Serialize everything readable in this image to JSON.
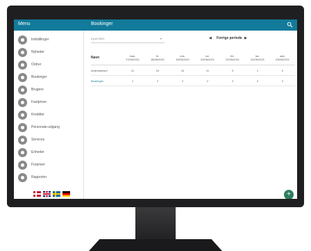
{
  "app": {
    "menu_title": "Menu",
    "page_title": "Bookinger"
  },
  "sidebar": {
    "items": [
      {
        "label": "Indstillinger",
        "icon": "settings-icon"
      },
      {
        "label": "Nyheder",
        "icon": "news-icon"
      },
      {
        "label": "Ordrer",
        "icon": "orders-icon"
      },
      {
        "label": "Bookinger",
        "icon": "bookings-icon"
      },
      {
        "label": "Brugere",
        "icon": "users-icon"
      },
      {
        "label": "Fastpriser",
        "icon": "fixed-price-icon"
      },
      {
        "label": "Kreditter",
        "icon": "credits-icon"
      },
      {
        "label": "Personale-udgang",
        "icon": "staff-exit-icon"
      },
      {
        "label": "Services",
        "icon": "services-icon"
      },
      {
        "label": "Enheder",
        "icon": "devices-icon"
      },
      {
        "label": "Forpriser",
        "icon": "pricing-icon"
      },
      {
        "label": "Rapporter",
        "icon": "reports-icon"
      }
    ],
    "languages": [
      "Dansk",
      "English",
      "Svenska",
      "Deutsch"
    ]
  },
  "filters": {
    "date_value": "4 juni 2021"
  },
  "week_nav": {
    "label": "Forrige periode"
  },
  "table": {
    "name_header": "Navn",
    "columns": [
      {
        "day": "man.",
        "date": "17/05/2021"
      },
      {
        "day": "tir.",
        "date": "18/05/2021"
      },
      {
        "day": "ons.",
        "date": "19/05/2021"
      },
      {
        "day": "tor.",
        "date": "20/05/2021"
      },
      {
        "day": "fre.",
        "date": "21/05/2021"
      },
      {
        "day": "lør.",
        "date": "22/05/2021"
      },
      {
        "day": "søn.",
        "date": "23/05/2021"
      }
    ],
    "rows": [
      {
        "label": "Andreasmyre",
        "values": [
          "11",
          "10",
          "10",
          "11",
          "0",
          "1",
          "0"
        ]
      },
      {
        "label": "Bookinger",
        "values": [
          "1",
          "2",
          "2",
          "2",
          "2",
          "2",
          "2"
        ]
      }
    ]
  },
  "fab": {
    "label": "+"
  },
  "colors": {
    "appbar": "#127a9b",
    "fab": "#2e7d5b",
    "monitor": "#1f1f21"
  }
}
